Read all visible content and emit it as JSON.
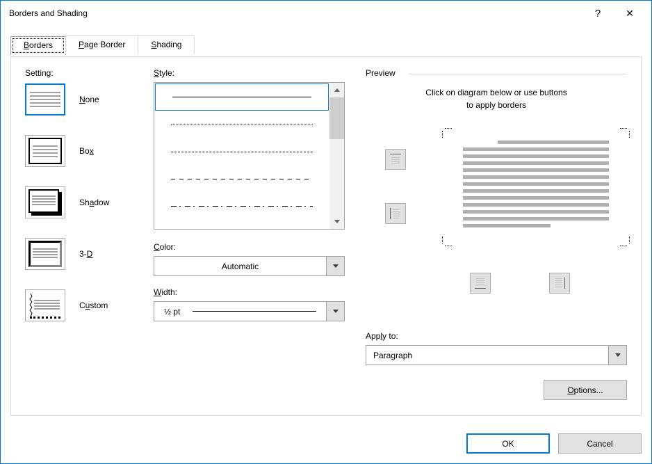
{
  "title": "Borders and Shading",
  "tabs": {
    "borders": {
      "prefix": "B",
      "rest": "orders"
    },
    "page_border": {
      "prefix": "P",
      "rest": "age Border"
    },
    "shading": {
      "prefix": "S",
      "rest": "hading"
    }
  },
  "setting": {
    "label": "Setting:",
    "none": {
      "prefix": "N",
      "rest": "one"
    },
    "box": {
      "prefix": "",
      "label_a": "Bo",
      "u": "x",
      "label_b": ""
    },
    "shadow": {
      "label_a": "Sh",
      "u": "a",
      "label_b": "dow"
    },
    "threed": {
      "label_a": "3-",
      "u": "D",
      "label_b": ""
    },
    "custom": {
      "label_a": "C",
      "u": "u",
      "label_b": "stom"
    }
  },
  "style_label": {
    "u": "S",
    "rest": "tyle:"
  },
  "color": {
    "label_u": "C",
    "label_rest": "olor:",
    "value": "Automatic"
  },
  "width": {
    "label_u": "W",
    "label_rest": "idth:",
    "value": "½ pt"
  },
  "preview": {
    "label": "Preview",
    "hint_l1": "Click on diagram below or use buttons",
    "hint_l2": "to apply borders"
  },
  "apply": {
    "label_a": "App",
    "u": "l",
    "label_b": "y to:",
    "value": "Paragraph"
  },
  "options": {
    "u": "O",
    "rest": "ptions..."
  },
  "buttons": {
    "ok": "OK",
    "cancel": "Cancel"
  },
  "titlebar": {
    "help": "?",
    "close": "✕"
  }
}
